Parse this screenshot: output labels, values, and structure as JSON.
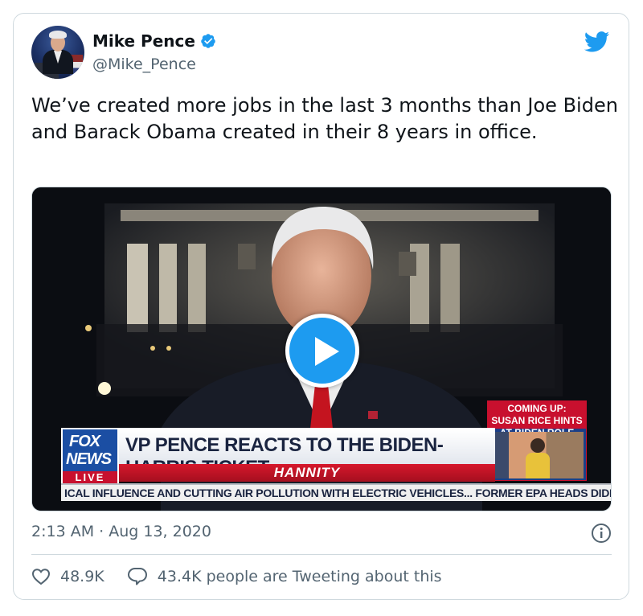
{
  "author": {
    "name": "Mike Pence",
    "handle": "@Mike_Pence"
  },
  "tweet": {
    "text": "We’ve created more jobs in the last 3 months than Joe Biden and Barack Obama created in their 8 years in office."
  },
  "video": {
    "network_logo_top": "FOX",
    "network_logo_bottom": "NEWS",
    "network_live": "LIVE",
    "headline": "VP PENCE REACTS TO THE BIDEN-HARRIS TICKET",
    "show": "HANNITY",
    "ticker": "ICAL INFLUENCE AND CUTTING AIR POLLUTION WITH ELECTRIC VEHICLES...   FORMER EPA HEADS DIDN'T M",
    "coming_up": "COMING UP: SUSAN RICE HINTS AT BIDEN ROLE"
  },
  "timestamp": "2:13 AM · Aug 13, 2020",
  "actions": {
    "likes": "48.9K",
    "replies": "43.4K people are Tweeting about this"
  },
  "colors": {
    "brand_blue": "#1d9bf0",
    "text_secondary": "#536471",
    "border": "#cfd9de"
  },
  "icons": {
    "verified": "verified-badge-icon",
    "brand": "twitter-bird-icon",
    "play": "play-icon",
    "info": "info-icon",
    "like": "heart-icon",
    "reply": "speech-bubble-icon"
  }
}
